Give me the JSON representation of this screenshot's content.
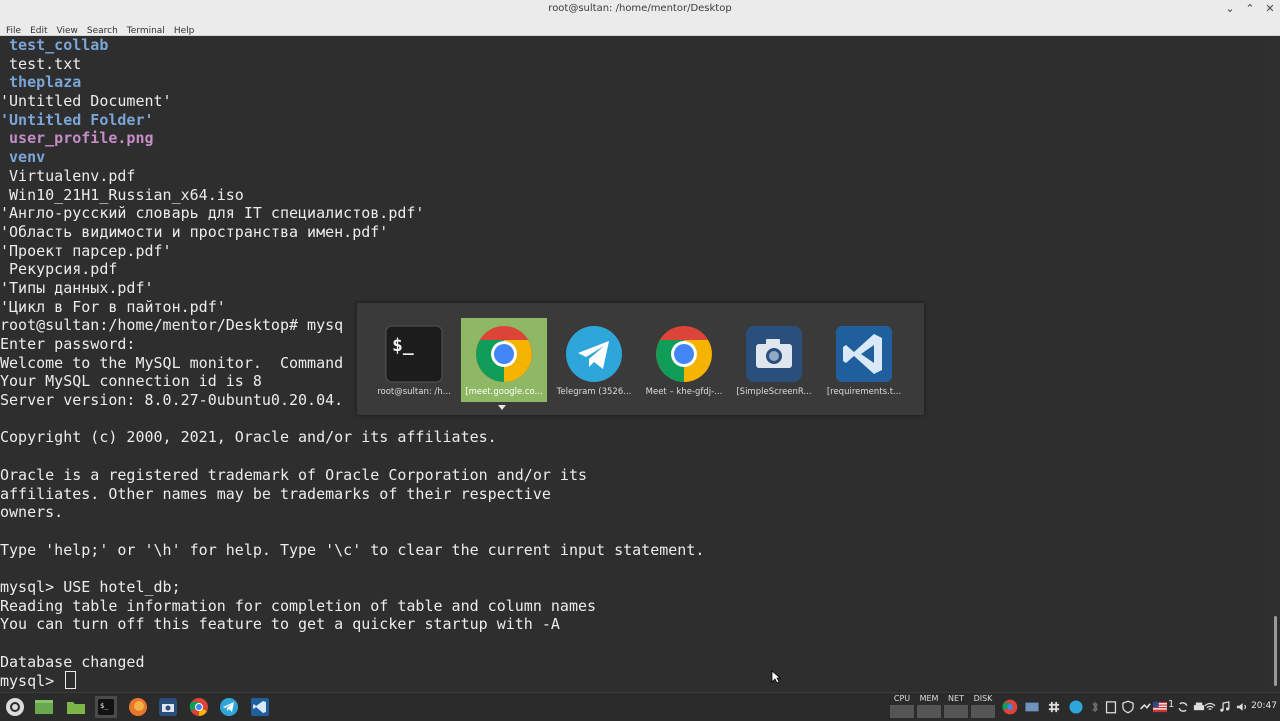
{
  "window": {
    "title": "root@sultan: /home/mentor/Desktop",
    "minimize_glyph": "⌄",
    "maximize_glyph": "⌃",
    "close_glyph": "✕"
  },
  "menu": [
    "File",
    "Edit",
    "View",
    "Search",
    "Terminal",
    "Help"
  ],
  "terminal_lines": [
    {
      "text": " test_collab",
      "kind": "dir"
    },
    {
      "text": " test.txt",
      "kind": "plain"
    },
    {
      "text": " theplaza",
      "kind": "dir"
    },
    {
      "text": "'Untitled Document'",
      "kind": "plain"
    },
    {
      "text": "'Untitled Folder'",
      "kind": "dir"
    },
    {
      "text": " user_profile.png",
      "kind": "img"
    },
    {
      "text": " venv",
      "kind": "dir"
    },
    {
      "text": " Virtualenv.pdf",
      "kind": "plain"
    },
    {
      "text": " Win10_21H1_Russian_x64.iso",
      "kind": "plain"
    },
    {
      "text": "'Англо-русский словарь для IT специалистов.pdf'",
      "kind": "plain"
    },
    {
      "text": "'Область видимости и пространства имен.pdf'",
      "kind": "plain"
    },
    {
      "text": "'Проект парсер.pdf'",
      "kind": "plain"
    },
    {
      "text": " Рекурсия.pdf",
      "kind": "plain"
    },
    {
      "text": "'Типы данных.pdf'",
      "kind": "plain"
    },
    {
      "text": "'Цикл в For в пайтон.pdf'",
      "kind": "plain"
    },
    {
      "text": "root@sultan:/home/mentor/Desktop# mysq",
      "kind": "plain"
    },
    {
      "text": "Enter password:",
      "kind": "plain"
    },
    {
      "text": "Welcome to the MySQL monitor.  Command",
      "kind": "plain"
    },
    {
      "text": "Your MySQL connection id is 8",
      "kind": "plain"
    },
    {
      "text": "Server version: 8.0.27-0ubuntu0.20.04.",
      "kind": "plain"
    },
    {
      "text": "",
      "kind": "plain"
    },
    {
      "text": "Copyright (c) 2000, 2021, Oracle and/or its affiliates.",
      "kind": "plain"
    },
    {
      "text": "",
      "kind": "plain"
    },
    {
      "text": "Oracle is a registered trademark of Oracle Corporation and/or its",
      "kind": "plain"
    },
    {
      "text": "affiliates. Other names may be trademarks of their respective",
      "kind": "plain"
    },
    {
      "text": "owners.",
      "kind": "plain"
    },
    {
      "text": "",
      "kind": "plain"
    },
    {
      "text": "Type 'help;' or '\\h' for help. Type '\\c' to clear the current input statement.",
      "kind": "plain"
    },
    {
      "text": "",
      "kind": "plain"
    },
    {
      "text": "mysql> USE hotel_db;",
      "kind": "plain"
    },
    {
      "text": "Reading table information for completion of table and column names",
      "kind": "plain"
    },
    {
      "text": "You can turn off this feature to get a quicker startup with -A",
      "kind": "plain"
    },
    {
      "text": "",
      "kind": "plain"
    },
    {
      "text": "Database changed",
      "kind": "plain"
    }
  ],
  "prompt": "mysql> ",
  "switcher": {
    "items": [
      {
        "label": "root@sultan: /h...",
        "icon": "terminal-icon",
        "selected": false
      },
      {
        "label": "[meet.google.co...",
        "icon": "chrome-icon",
        "selected": true
      },
      {
        "label": "Telegram (3526...",
        "icon": "telegram-icon",
        "selected": false
      },
      {
        "label": "Meet – khe-gfdj-...",
        "icon": "chrome-icon",
        "selected": false
      },
      {
        "label": "[SimpleScreenR...",
        "icon": "camera-icon",
        "selected": false
      },
      {
        "label": "[requirements.t...",
        "icon": "vscode-icon",
        "selected": false
      }
    ]
  },
  "panel": {
    "monitors": [
      "CPU",
      "MEM",
      "NET",
      "DISK"
    ],
    "tray_language": "1",
    "clock": "20:47"
  },
  "colors": {
    "terminal_bg": "#2e2e2e",
    "dir": "#7aa5d8",
    "image": "#c58dc7",
    "selection": "#8fb865"
  }
}
